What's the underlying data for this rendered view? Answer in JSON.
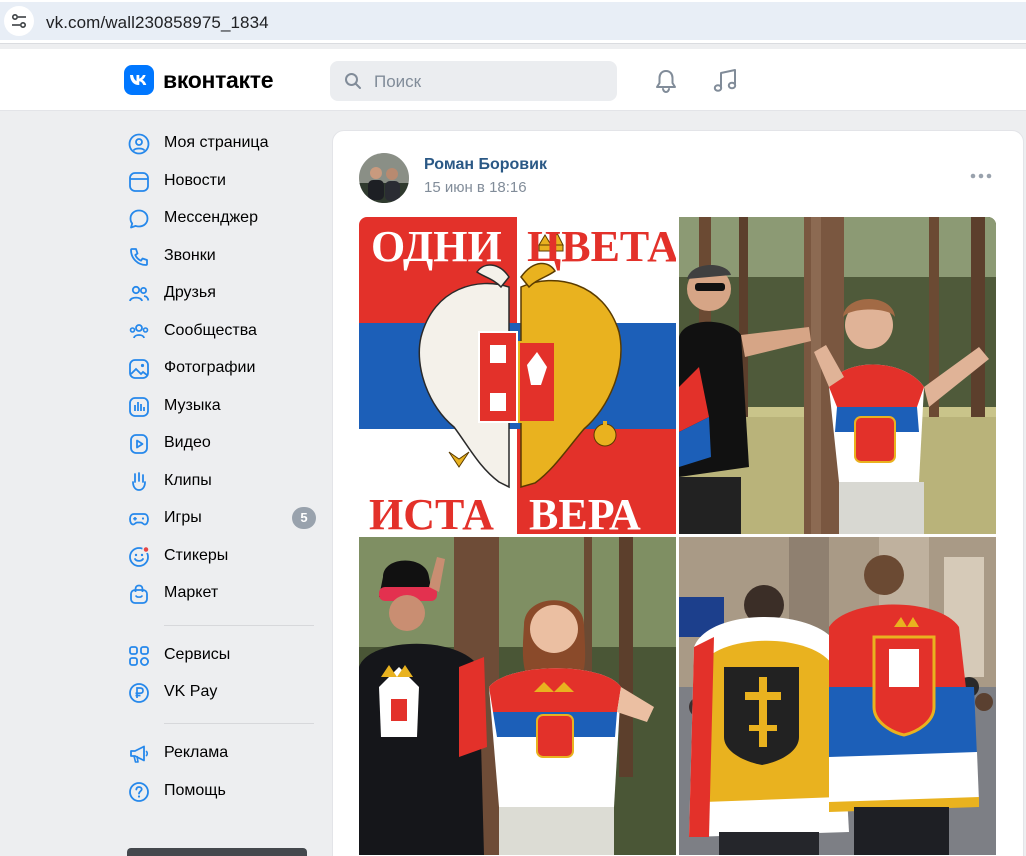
{
  "browser": {
    "url": "vk.com/wall230858975_1834",
    "site_settings_icon": "tune-icon"
  },
  "header": {
    "brand": "вконтакте",
    "search_placeholder": "Поиск",
    "icons": [
      "vk-logo-icon",
      "search-icon",
      "bell-icon",
      "music-note-icon"
    ]
  },
  "nav": {
    "items": [
      {
        "label": "Моя страница",
        "icon": "user-circle-icon"
      },
      {
        "label": "Новости",
        "icon": "news-icon"
      },
      {
        "label": "Мессенджер",
        "icon": "message-bubble-icon"
      },
      {
        "label": "Звонки",
        "icon": "phone-icon"
      },
      {
        "label": "Друзья",
        "icon": "friends-icon"
      },
      {
        "label": "Сообщества",
        "icon": "communities-icon"
      },
      {
        "label": "Фотографии",
        "icon": "photo-icon"
      },
      {
        "label": "Музыка",
        "icon": "music-icon"
      },
      {
        "label": "Видео",
        "icon": "video-icon"
      },
      {
        "label": "Клипы",
        "icon": "clips-icon"
      },
      {
        "label": "Игры",
        "icon": "gamepad-icon",
        "badge": "5"
      },
      {
        "label": "Стикеры",
        "icon": "sticker-icon"
      },
      {
        "label": "Маркет",
        "icon": "market-bag-icon"
      }
    ],
    "secondary": [
      {
        "label": "Сервисы",
        "icon": "services-grid-icon"
      },
      {
        "label": "VK Pay",
        "icon": "vk-pay-icon"
      }
    ],
    "tertiary": [
      {
        "label": "Реклама",
        "icon": "megaphone-icon"
      },
      {
        "label": "Помощь",
        "icon": "help-icon"
      }
    ]
  },
  "post": {
    "author": "Роман Боровик",
    "date": "15 июн в 18:16",
    "more_icon": "more-dots-icon",
    "photos": {
      "poster": {
        "top_left_text": "ОДНИ",
        "top_right_text": "ЦВЕТА",
        "bottom_left_text": "ИСТА",
        "bottom_right_text": "ВЕРА"
      },
      "count": 4
    }
  },
  "colors": {
    "vk_blue": "#0077ff",
    "link": "#2a5885",
    "secondary_text": "#818c99",
    "background": "#edeef0",
    "serbia_red": "#e3312a",
    "serbia_blue": "#1c5fb8"
  }
}
